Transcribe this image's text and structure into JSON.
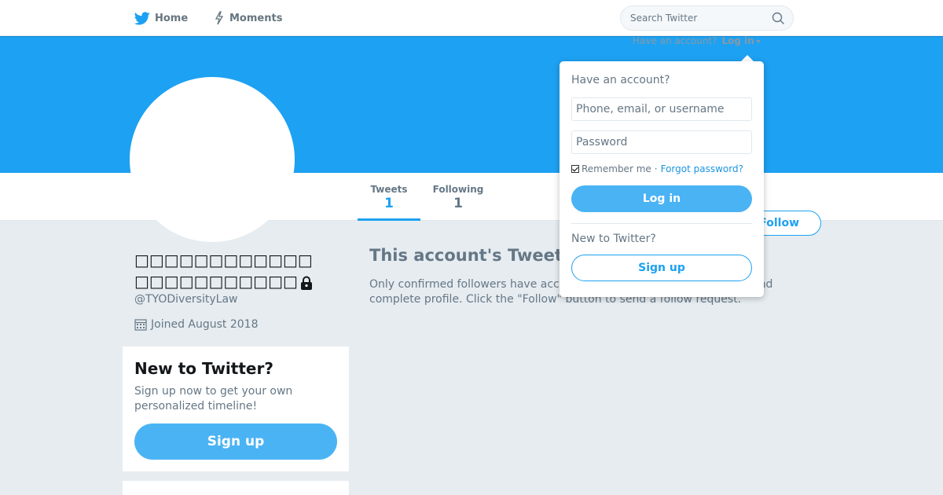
{
  "nav": {
    "home_label": "Home",
    "moments_label": "Moments",
    "search_placeholder": "Search Twitter",
    "home_icon": "twitter-bird-icon",
    "moments_icon": "lightning-icon",
    "search_icon": "search-icon"
  },
  "header": {
    "login_prompt": "Have an account?",
    "login_link": "Log in",
    "cover_color": "#1da1f2"
  },
  "stats": {
    "tweets_label": "Tweets",
    "tweets_value": "1",
    "following_label": "Following",
    "following_value": "1"
  },
  "follow_button": "Follow",
  "profile": {
    "display_name": "□□□□□□□□□□□□□□□□□□□□□□□",
    "handle": "@TYODiversityLaw",
    "joined": "Joined August 2018",
    "lock_icon": "lock-icon",
    "calendar_icon": "calendar-icon"
  },
  "signup_card": {
    "title": "New to Twitter?",
    "text": "Sign up now to get your own personalized timeline!",
    "button": "Sign up"
  },
  "timeline": {
    "title": "This account's Tweets are protected.",
    "text": "Only confirmed followers have access to @TYODiversityLaw's Tweets and complete profile. Click the \"Follow\" button to send a follow request."
  },
  "login_dropdown": {
    "heading": "Have an account?",
    "username_placeholder": "Phone, email, or username",
    "password_placeholder": "Password",
    "remember_label": "Remember me",
    "separator": "·",
    "forgot_label": "Forgot password?",
    "login_button": "Log in",
    "new_label": "New to Twitter?",
    "signup_button": "Sign up"
  },
  "colors": {
    "accent": "#1da1f2",
    "button_fill": "#4ab3f4",
    "background": "#e6ecf0"
  }
}
